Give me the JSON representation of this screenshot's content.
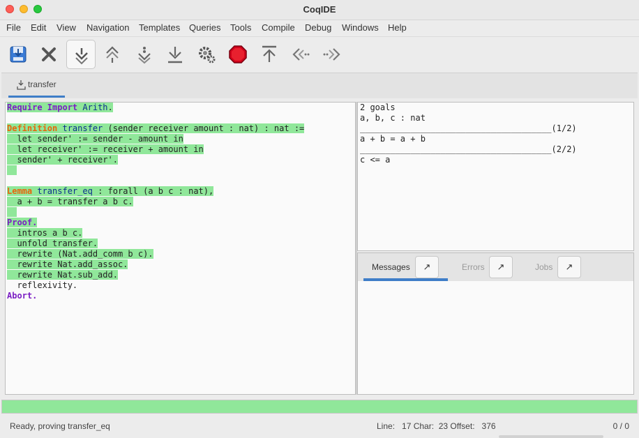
{
  "window": {
    "title": "CoqIDE"
  },
  "menu": [
    "File",
    "Edit",
    "View",
    "Navigation",
    "Templates",
    "Queries",
    "Tools",
    "Compile",
    "Debug",
    "Windows",
    "Help"
  ],
  "toolbar": {
    "buttons": [
      {
        "name": "save-icon"
      },
      {
        "name": "close-icon"
      },
      {
        "name": "forward-one-icon"
      },
      {
        "name": "backward-one-icon"
      },
      {
        "name": "go-to-cursor-icon"
      },
      {
        "name": "go-to-end-icon"
      },
      {
        "name": "compile-gear-icon"
      },
      {
        "name": "interrupt-stop-icon"
      },
      {
        "name": "go-to-start-icon"
      },
      {
        "name": "previous-occurrence-icon"
      },
      {
        "name": "next-occurrence-icon"
      }
    ]
  },
  "document_tab": {
    "label": "transfer"
  },
  "editor": {
    "lines": [
      [
        "Require Import",
        " ",
        "Arith",
        "."
      ],
      [
        ""
      ],
      [
        "Definition",
        " ",
        "transfer",
        " (sender receiver amount : nat) : nat :="
      ],
      [
        "  let sender' := sender - amount in"
      ],
      [
        "  let receiver' := receiver + amount in"
      ],
      [
        "  sender' + receiver'."
      ],
      [
        "  "
      ],
      [
        ""
      ],
      [
        "Lemma",
        " ",
        "transfer_eq",
        " : forall (a b c : nat),"
      ],
      [
        "  a + b = transfer a b c."
      ],
      [
        "  "
      ],
      [
        "Proof."
      ],
      [
        "  intros a b c."
      ],
      [
        "  unfold transfer."
      ],
      [
        "  rewrite (Nat.add_comm b c)."
      ],
      [
        "  rewrite Nat.add_assoc."
      ],
      [
        "  rewrite Nat.sub_add."
      ],
      [
        "  reflexivity."
      ],
      [
        "Abort."
      ]
    ]
  },
  "goals": {
    "text": "2 goals\na, b, c : nat\n______________________________________(1/2)\na + b = a + b\n______________________________________(2/2)\nc <= a"
  },
  "message_tabs": [
    {
      "label": "Messages",
      "button": "↗",
      "active": true
    },
    {
      "label": "Errors",
      "button": "↗",
      "active": false
    },
    {
      "label": "Jobs",
      "button": "↗",
      "active": false
    }
  ],
  "status": {
    "text": "Ready, proving transfer_eq",
    "position": "Line:   17 Char:  23 Offset:   376",
    "count": "0 / 0"
  },
  "colors": {
    "processed": "#90e79a",
    "keyword": "#7b1fc4",
    "definition_keyword": "#e8650c",
    "identifier": "#0d2f8e",
    "accent": "#3f7ec8"
  }
}
